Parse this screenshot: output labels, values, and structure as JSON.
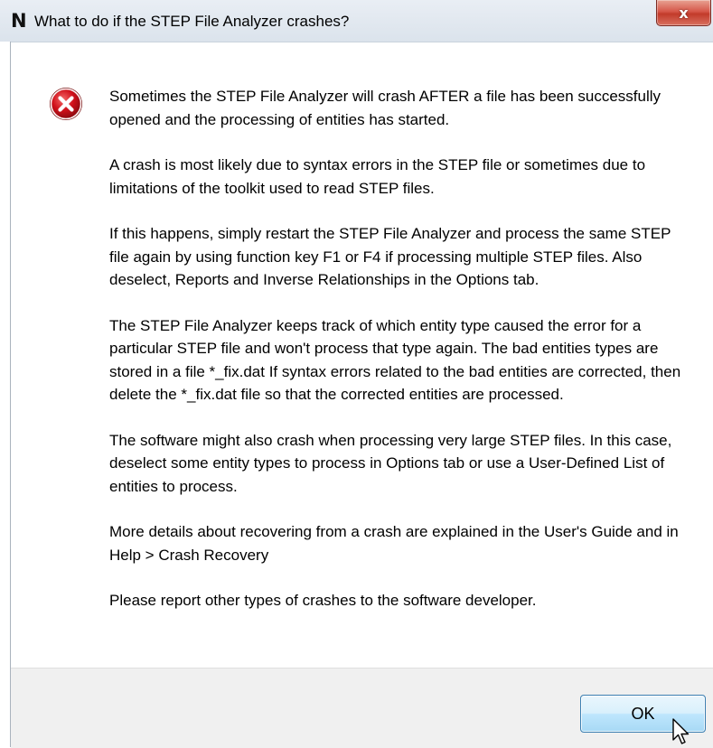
{
  "window": {
    "title": "What to do if the STEP File Analyzer crashes?",
    "app_icon_letter": "N",
    "close_label": "x"
  },
  "dialog": {
    "icon": "error-icon",
    "paragraphs": [
      "Sometimes the STEP File Analyzer will crash AFTER a file has been successfully opened and the processing of entities has started.",
      "A crash is most likely due to syntax errors in the STEP file or sometimes due to limitations of the toolkit used to read STEP files.",
      "If this happens, simply restart the STEP File Analyzer and process the same STEP file again by using function key F1 or F4 if processing multiple STEP files.  Also deselect, Reports and Inverse Relationships in the Options tab.",
      "The STEP File Analyzer keeps track of which entity type caused the error for a particular STEP file and won't process that type again.  The bad entities types are stored in a file *_fix.dat  If syntax errors related to the bad entities are corrected, then delete the *_fix.dat file so that the corrected entities are processed.",
      "The software might also crash when processing very large STEP files.  In this case, deselect some entity types to process in Options tab or use a User-Defined List of entities to process.",
      "More details about recovering from a crash are explained in the User's Guide and in Help > Crash Recovery",
      "Please report other types of crashes to the software developer."
    ]
  },
  "footer": {
    "ok_label": "OK"
  },
  "colors": {
    "title_bar": "#dbe3ec",
    "close_button": "#c23a2a",
    "footer_bg": "#f0f0f0",
    "ok_button_border": "#3c7fb1",
    "error_icon": "#d0101a"
  }
}
